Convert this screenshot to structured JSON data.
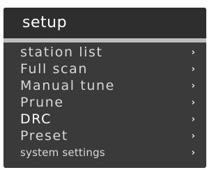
{
  "header": {
    "title": "setup"
  },
  "menu": {
    "chevron_glyph": "›",
    "chevron_icon": "chevron-right-icon",
    "items": [
      {
        "label": "station list"
      },
      {
        "label": "Full scan"
      },
      {
        "label": "Manual tune"
      },
      {
        "label": "Prune"
      },
      {
        "label": "DRC"
      },
      {
        "label": "Preset"
      },
      {
        "label": "system settings"
      }
    ]
  },
  "colors": {
    "background": "#3a3a3a",
    "title_bar": "#2e2e2e",
    "divider": "#bdbdbd",
    "text": "#d8d8d8",
    "text_highlight": "#ffffff"
  }
}
